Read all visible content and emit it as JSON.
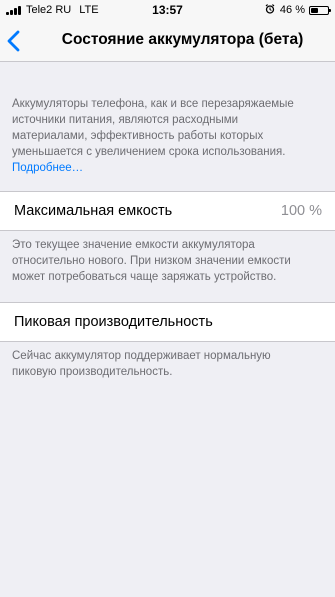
{
  "status_bar": {
    "carrier": "Tele2 RU",
    "network": "LTE",
    "time": "13:57",
    "battery_percent_label": "46 %",
    "battery_level": 0.46,
    "alarm_icon": "alarm-clock-icon"
  },
  "nav": {
    "back_icon": "chevron-left-icon",
    "title": "Состояние аккумулятора (бета)"
  },
  "intro": {
    "lines": [
      "Аккумуляторы телефона, как и все перезаряжаемые",
      "источники питания, являются расходными",
      "материалами, эффективность работы которых",
      "уменьшается с увеличением срока использования."
    ],
    "more_link": "Подробнее…"
  },
  "max_capacity": {
    "label": "Максимальная емкость",
    "value": "100 %",
    "note_lines": [
      "Это текущее значение емкости аккумулятора",
      "относительно нового. При низком значении емкости",
      "может потребоваться чаще заряжать устройство."
    ]
  },
  "peak_performance": {
    "label": "Пиковая производительность",
    "note_lines": [
      "Сейчас аккумулятор поддерживает нормальную",
      "пиковую производительность."
    ]
  },
  "colors": {
    "accent": "#007aff",
    "background": "#efeff4",
    "secondary_text": "#6d6d72"
  }
}
